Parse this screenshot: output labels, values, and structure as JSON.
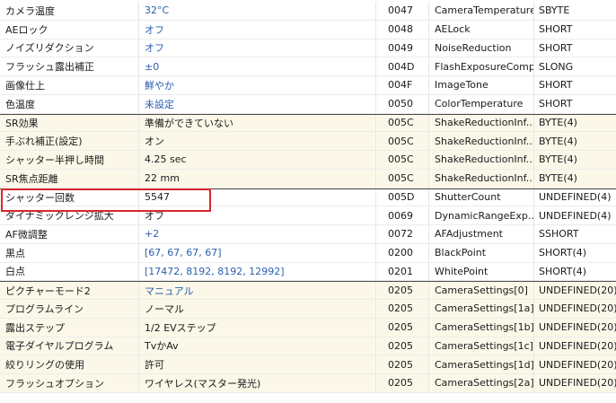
{
  "rows": [
    {
      "name": "カメラ温度",
      "value": "32°C",
      "blue": true,
      "tag": "0047",
      "tagname": "CameraTemperature",
      "type": "SBYTE",
      "yellow": false,
      "sep": false
    },
    {
      "name": "AEロック",
      "value": "オフ",
      "blue": true,
      "tag": "0048",
      "tagname": "AELock",
      "type": "SHORT",
      "yellow": false,
      "sep": false
    },
    {
      "name": "ノイズリダクション",
      "value": "オフ",
      "blue": true,
      "tag": "0049",
      "tagname": "NoiseReduction",
      "type": "SHORT",
      "yellow": false,
      "sep": false
    },
    {
      "name": "フラッシュ露出補正",
      "value": "±0",
      "blue": true,
      "tag": "004D",
      "tagname": "FlashExposureComp",
      "type": "SLONG",
      "yellow": false,
      "sep": false
    },
    {
      "name": "画像仕上",
      "value": "鮮やか",
      "blue": true,
      "tag": "004F",
      "tagname": "ImageTone",
      "type": "SHORT",
      "yellow": false,
      "sep": false
    },
    {
      "name": "色温度",
      "value": "未設定",
      "blue": true,
      "tag": "0050",
      "tagname": "ColorTemperature",
      "type": "SHORT",
      "yellow": false,
      "sep": false
    },
    {
      "name": "SR効果",
      "value": "準備ができていない",
      "blue": false,
      "tag": "005C",
      "tagname": "ShakeReductionInf...",
      "type": "BYTE(4)",
      "yellow": true,
      "sep": true
    },
    {
      "name": "手ぶれ補正(設定)",
      "value": "オン",
      "blue": false,
      "tag": "005C",
      "tagname": "ShakeReductionInf...",
      "type": "BYTE(4)",
      "yellow": true,
      "sep": false
    },
    {
      "name": "シャッター半押し時間",
      "value": "4.25 sec",
      "blue": false,
      "tag": "005C",
      "tagname": "ShakeReductionInf...",
      "type": "BYTE(4)",
      "yellow": true,
      "sep": false
    },
    {
      "name": "SR焦点距離",
      "value": "22 mm",
      "blue": false,
      "tag": "005C",
      "tagname": "ShakeReductionInf...",
      "type": "BYTE(4)",
      "yellow": true,
      "sep": false
    },
    {
      "name": "シャッター回数",
      "value": "5547",
      "blue": false,
      "tag": "005D",
      "tagname": "ShutterCount",
      "type": "UNDEFINED(4)",
      "yellow": false,
      "sep": true
    },
    {
      "name": "ダイナミックレンジ拡大",
      "value": "オフ",
      "blue": false,
      "tag": "0069",
      "tagname": "DynamicRangeExp...",
      "type": "UNDEFINED(4)",
      "yellow": false,
      "sep": false
    },
    {
      "name": "AF微調整",
      "value": "+2",
      "blue": true,
      "tag": "0072",
      "tagname": "AFAdjustment",
      "type": "SSHORT",
      "yellow": false,
      "sep": false
    },
    {
      "name": "黒点",
      "value": "[67, 67, 67, 67]",
      "blue": true,
      "tag": "0200",
      "tagname": "BlackPoint",
      "type": "SHORT(4)",
      "yellow": false,
      "sep": false
    },
    {
      "name": "白点",
      "value": "[17472, 8192, 8192, 12992]",
      "blue": true,
      "tag": "0201",
      "tagname": "WhitePoint",
      "type": "SHORT(4)",
      "yellow": false,
      "sep": false
    },
    {
      "name": "ピクチャーモード2",
      "value": "マニュアル",
      "blue": true,
      "tag": "0205",
      "tagname": "CameraSettings[0]",
      "type": "UNDEFINED(20)",
      "yellow": true,
      "sep": true
    },
    {
      "name": "プログラムライン",
      "value": "ノーマル",
      "blue": false,
      "tag": "0205",
      "tagname": "CameraSettings[1a]",
      "type": "UNDEFINED(20)",
      "yellow": true,
      "sep": false
    },
    {
      "name": "露出ステップ",
      "value": "1/2 EVステップ",
      "blue": false,
      "tag": "0205",
      "tagname": "CameraSettings[1b]",
      "type": "UNDEFINED(20)",
      "yellow": true,
      "sep": false
    },
    {
      "name": "電子ダイヤルプログラム",
      "value": "TvかAv",
      "blue": false,
      "tag": "0205",
      "tagname": "CameraSettings[1c]",
      "type": "UNDEFINED(20)",
      "yellow": true,
      "sep": false
    },
    {
      "name": "絞りリングの使用",
      "value": "許可",
      "blue": false,
      "tag": "0205",
      "tagname": "CameraSettings[1d]",
      "type": "UNDEFINED(20)",
      "yellow": true,
      "sep": false
    },
    {
      "name": "フラッシュオプション",
      "value": "ワイヤレス(マスター発光)",
      "blue": false,
      "tag": "0205",
      "tagname": "CameraSettings[2a]",
      "type": "UNDEFINED(20)",
      "yellow": true,
      "sep": false
    }
  ],
  "highlight_row_name": "シャッター回数",
  "colors": {
    "highlight_box": "#d8262b",
    "value_blue": "#2a5fae",
    "group_yellow": "#fcf8e9"
  }
}
